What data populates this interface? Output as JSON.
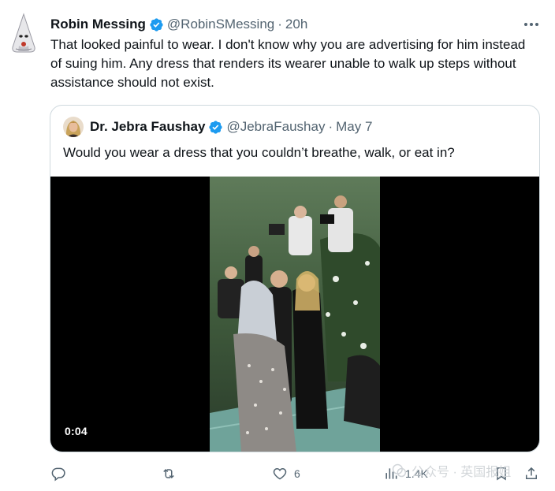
{
  "tweet": {
    "author_name": "Robin Messing",
    "author_handle": "@RobinSMessing",
    "separator": "·",
    "time": "20h",
    "text": "That looked painful to wear. I don't know why you are advertising for him instead of suing him. Any dress that renders its wearer unable to walk up steps without assistance should not exist."
  },
  "quote": {
    "author_name": "Dr. Jebra Faushay",
    "author_handle": "@JebraFaushay",
    "separator": "·",
    "date": "May 7",
    "text": "Would you wear a dress that you couldn’t breathe, walk, or eat in?",
    "video_time": "0:04"
  },
  "actions": {
    "reply_count": "",
    "retweet_count": "",
    "like_count": "6",
    "views_count": "1.4K"
  },
  "watermark": {
    "text": "公众号 · 英国报姐"
  },
  "colors": {
    "verified": "#1d9bf0",
    "secondary_text": "#536471",
    "border": "#cfd9de"
  }
}
